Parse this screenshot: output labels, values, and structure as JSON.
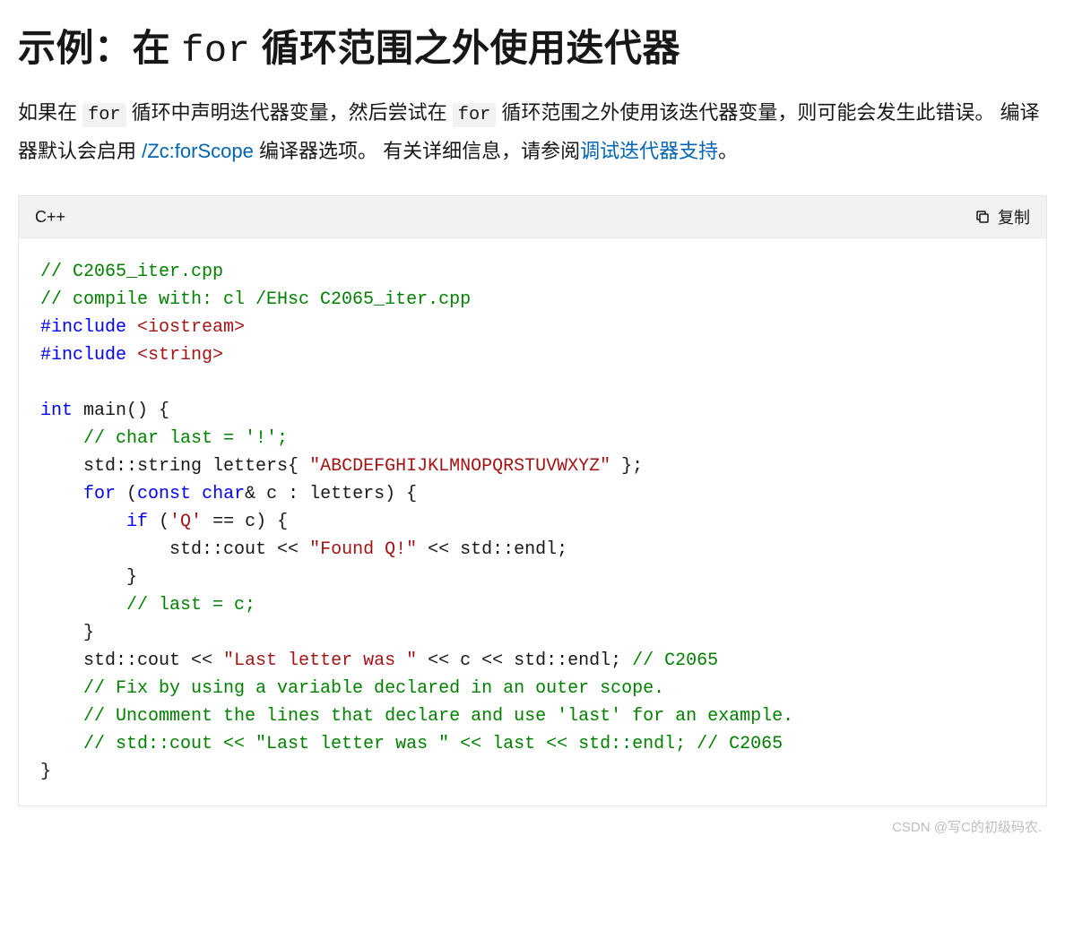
{
  "title": {
    "prefix": "示例：在 ",
    "code": "for",
    "suffix": " 循环范围之外使用迭代器"
  },
  "paragraph": {
    "t1": "如果在 ",
    "for1": "for",
    "t2": " 循环中声明迭代器变量，然后尝试在 ",
    "for2": "for",
    "t3": " 循环范围之外使用该迭代器变量，则可能会发生此错误。 编译器默认会启用 ",
    "link1": "/Zc:forScope",
    "t4": " 编译器选项。 有关详细信息，请参阅",
    "link2": "调试迭代器支持",
    "t5": "。"
  },
  "codeblock": {
    "lang": "C++",
    "copy_label": "复制",
    "lines": {
      "l1": "// C2065_iter.cpp",
      "l2": "// compile with: cl /EHsc C2065_iter.cpp",
      "l3a": "#include",
      "l3b": " <iostream>",
      "l4a": "#include",
      "l4b": " <string>",
      "l6a": "int",
      "l6b": " main() {",
      "l7": "    // char last = '!';",
      "l8a": "    std::string letters{ ",
      "l8b": "\"ABCDEFGHIJKLMNOPQRSTUVWXYZ\"",
      "l8c": " };",
      "l9a": "    ",
      "l9b": "for",
      "l9c": " (",
      "l9d": "const",
      "l9e": " ",
      "l9f": "char",
      "l9g": "& c : letters) {",
      "l10a": "        ",
      "l10b": "if",
      "l10c": " (",
      "l10d": "'Q'",
      "l10e": " == c) {",
      "l11a": "            std::cout << ",
      "l11b": "\"Found Q!\"",
      "l11c": " << std::endl;",
      "l12": "        }",
      "l13": "        // last = c;",
      "l14": "    }",
      "l15a": "    std::cout << ",
      "l15b": "\"Last letter was \"",
      "l15c": " << c << std::endl; ",
      "l15d": "// C2065",
      "l16": "    // Fix by using a variable declared in an outer scope.",
      "l17": "    // Uncomment the lines that declare and use 'last' for an example.",
      "l18": "    // std::cout << \"Last letter was \" << last << std::endl; // C2065",
      "l19": "}"
    }
  },
  "watermark": "CSDN @写C的初级码农."
}
